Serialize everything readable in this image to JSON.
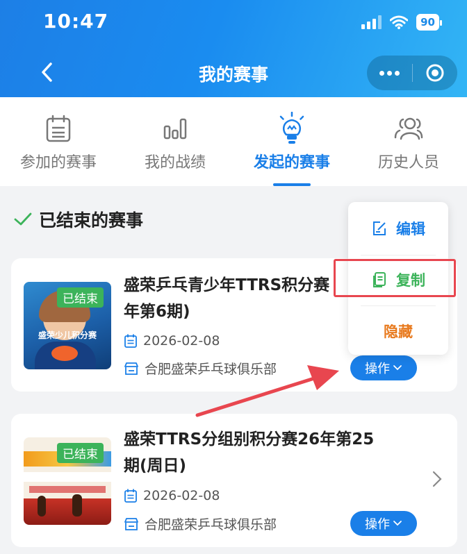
{
  "status": {
    "time": "10:47",
    "battery": "90"
  },
  "nav": {
    "title": "我的赛事"
  },
  "tabs": [
    {
      "label": "参加的赛事",
      "icon": "calendar-icon"
    },
    {
      "label": "我的战绩",
      "icon": "bar-chart-icon"
    },
    {
      "label": "发起的赛事",
      "icon": "lightbulb-icon",
      "active": true
    },
    {
      "label": "历史人员",
      "icon": "people-icon"
    }
  ],
  "section": {
    "title": "已结束的赛事"
  },
  "events": [
    {
      "title": "盛荣乒乓青少年TTRS积分赛年第6期)",
      "title_line1": "盛荣乒乓青少年TTRS积分赛",
      "title_line2": "年第6期)",
      "status_tag": "已结束",
      "thumb_text": "盛荣少儿积分赛",
      "date": "2026-02-08",
      "club": "合肥盛荣乒乓球俱乐部",
      "op_label": "操作"
    },
    {
      "title": "盛荣TTRS分组别积分赛26年第25期(周日)",
      "title_line1": "盛荣TTRS分组别积分赛26年第25",
      "title_line2": "期(周日)",
      "status_tag": "已结束",
      "date": "2026-02-08",
      "club": "合肥盛荣乒乓球俱乐部",
      "op_label": "操作"
    }
  ],
  "menu": {
    "edit": "编辑",
    "copy": "复制",
    "hide": "隐藏"
  },
  "colors": {
    "accent": "#1a7fe8",
    "green": "#3cb35a",
    "orange": "#e87a1e",
    "annotation": "#e8464f"
  }
}
